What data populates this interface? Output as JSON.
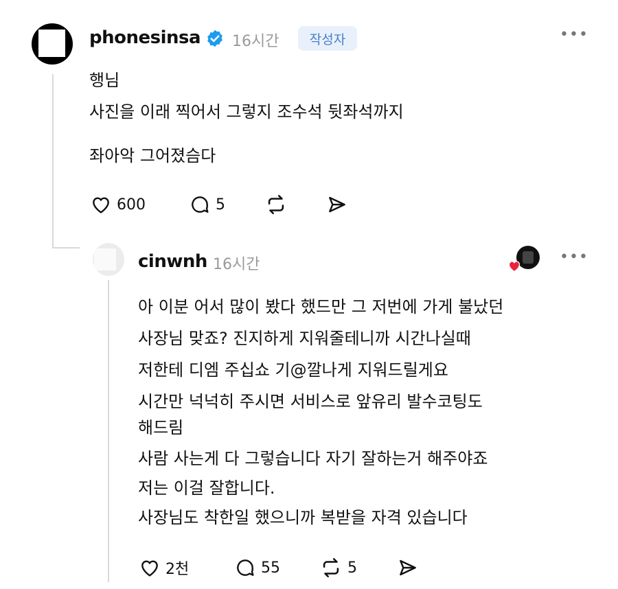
{
  "comment": {
    "username": "phonesinsa",
    "time": "16시간",
    "author_badge": "작성자",
    "more": "•••",
    "body": [
      "행님",
      "사진을 이래 찍어서 그렇지 조수석 뒷좌석까지",
      "좌아악 그어졌슴다"
    ],
    "likes": "600",
    "replies": "5"
  },
  "reply": {
    "username": "cinwnh",
    "time": "16시간",
    "more": "•••",
    "body": [
      "아 이분 어서 많이 봤다 했드만 그 저번에 가게 불났던",
      "사장님 맞죠? 진지하게 지워줄테니까 시간나실때",
      "저한테 디엠 주십쇼 기@깔나게 지워드릴게요",
      "시간만 넉넉히 주시면 서비스로 앞유리 발수코팅도",
      "해드림",
      "사람 사는게 다 그렇습니다 자기 잘하는거 해주야죠",
      "저는 이걸 잘합니다.",
      "사장님도 착한일 했으니까 복받을 자격 있습니다"
    ],
    "likes": "2천",
    "replies": "55",
    "reposts": "5"
  },
  "icons": {
    "like": "heart-icon",
    "reply": "comment-icon",
    "repost": "repost-icon",
    "share": "send-icon",
    "verified": "verified-badge-icon"
  },
  "colors": {
    "verified": "#1d9bf0",
    "badge_bg": "#e8f1fb",
    "badge_text": "#4a7fc8",
    "muted": "#9a9a9a",
    "heart_red": "#e8243c"
  }
}
